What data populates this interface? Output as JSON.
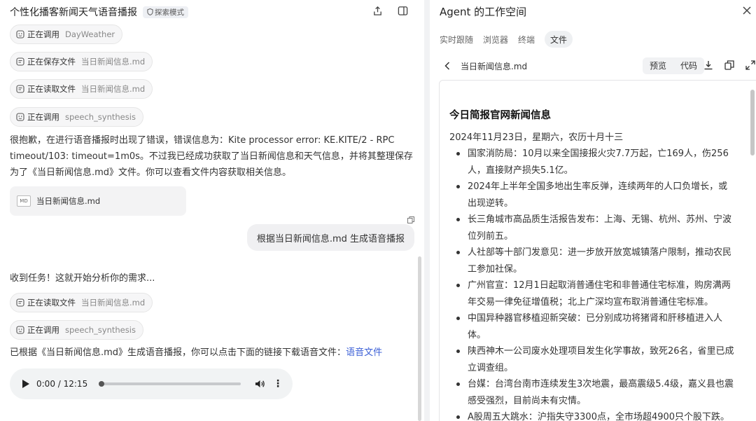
{
  "chat": {
    "title": "个性化播客新闻天气语音播报",
    "mode_badge": "探索模式",
    "tool_calls_1": [
      {
        "action": "正在调用",
        "target": "DayWeather"
      },
      {
        "action": "正在保存文件",
        "target": "当日新闻信息.md"
      },
      {
        "action": "正在读取文件",
        "target": "当日新闻信息.md"
      },
      {
        "action": "正在调用",
        "target": "speech_synthesis"
      }
    ],
    "assistant_msg_1": "很抱歉，在进行语音播报时出现了错误，错误信息为：Kite processor error: KE.KITE/2 - RPC timeout/103: timeout=1m0s。不过我已经成功获取了当日新闻信息和天气信息，并将其整理保存为了《当日新闻信息.md》文件。你可以查看文件内容获取相关信息。",
    "file_card": {
      "icon_text": "MD",
      "name": "当日新闻信息.md"
    },
    "user_msg": "根据当日新闻信息.md  生成语音播报",
    "assistant_msg_2": "收到任务！这就开始分析你的需求...",
    "tool_calls_2": [
      {
        "action": "正在读取文件",
        "target": "当日新闻信息.md"
      },
      {
        "action": "正在调用",
        "target": "speech_synthesis"
      }
    ],
    "assistant_msg_3_prefix": "已根据《当日新闻信息.md》生成语音播报，你可以点击下面的链接下载语音文件：",
    "assistant_msg_3_link": "语音文件",
    "audio": {
      "current": "0:00",
      "total": "12:15",
      "time_text": "0:00 / 12:15",
      "progress": 0
    }
  },
  "workspace": {
    "title": "Agent 的工作空间",
    "tabs": [
      "实时跟随",
      "浏览器",
      "终端",
      "文件"
    ],
    "active_tab": "文件",
    "file_name": "当日新闻信息.md",
    "view_toggle": [
      "预览",
      "代码"
    ],
    "active_view": "预览",
    "doc": {
      "title": "今日简报官网新闻信息",
      "date": "2024年11月23日，星期六，农历十月十三",
      "items": [
        "国家消防局：10月以来全国接报火灾7.7万起，亡169人，伤256人，直接财产损失5.1亿。",
        "2024年上半年全国多地出生率反弹，连续两年的人口负增长，或出现逆转。",
        "长三角城市高品质生活报告发布：上海、无锡、杭州、苏州、宁波位列前五。",
        "人社部等十部门发意见：进一步放开放宽城镇落户限制，推动农民工参加社保。",
        "广州官宣：12月1日起取消普通住宅和非普通住宅标准，购房满两年交易一律免征增值税；北上广深均宣布取消普通住宅标准。",
        "中国异种器官移植迎新突破：已分别成功将猪肾和肝移植进入人体。",
        "陕西神木一公司废水处理项目发生化学事故，致死26名，省里已成立调查组。",
        "台媒：台湾台南市连续发生3次地震，最高震级5.4级，嘉义县也震感受强烈，目前尚未有灾情。",
        "A股周五大跳水：沪指失守3300点，全市场超4900只个股下跌。"
      ]
    }
  },
  "colors": {
    "accent_link": "#3b5fd6",
    "chip_bg": "#f6f6f7",
    "divider": "#f1f2f4"
  }
}
